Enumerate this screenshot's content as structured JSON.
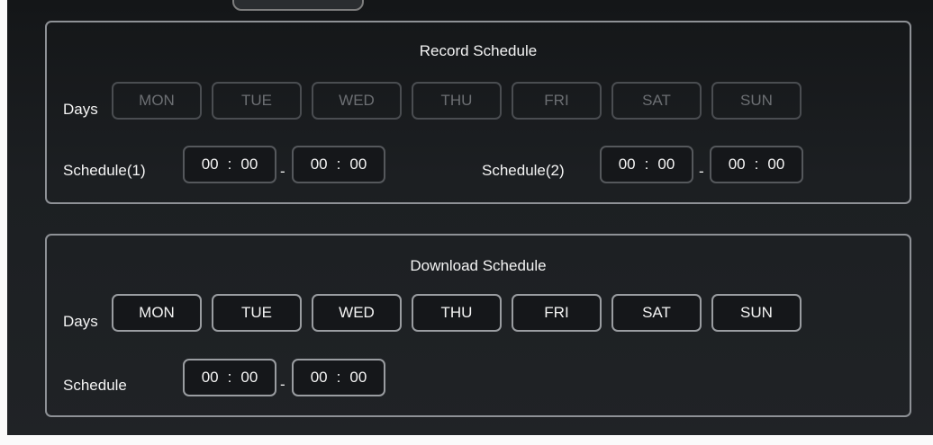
{
  "record": {
    "title": "Record Schedule",
    "days_label": "Days",
    "days": [
      "MON",
      "TUE",
      "WED",
      "THU",
      "FRI",
      "SAT",
      "SUN"
    ],
    "schedule1_label": "Schedule(1)",
    "schedule1": {
      "start_h": "00",
      "start_m": "00",
      "end_h": "00",
      "end_m": "00"
    },
    "schedule2_label": "Schedule(2)",
    "schedule2": {
      "start_h": "00",
      "start_m": "00",
      "end_h": "00",
      "end_m": "00"
    },
    "separator": ":",
    "range_dash": "-"
  },
  "download": {
    "title": "Download Schedule",
    "days_label": "Days",
    "days": [
      "MON",
      "TUE",
      "WED",
      "THU",
      "FRI",
      "SAT",
      "SUN"
    ],
    "schedule_label": "Schedule",
    "schedule": {
      "start_h": "00",
      "start_m": "00",
      "end_h": "00",
      "end_m": "00"
    },
    "separator": ":",
    "range_dash": "-"
  },
  "colors": {
    "background": "#1c1f22",
    "panel_border": "#8e9196",
    "disabled_text": "#6c6f73",
    "enabled_text": "#f4f4f4"
  }
}
